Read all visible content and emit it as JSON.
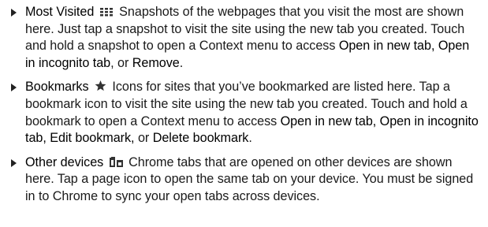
{
  "items": [
    {
      "term": "Most Visited",
      "icon": "grid-icon",
      "text1": " Snapshots of the webpages that you visit the most are shown here. Just tap a snapshot to visit the site using the new tab you created. Touch and hold a snapshot to open a Context menu to access ",
      "kw1": "Open in new tab, Open in incognito tab",
      "sep1": ", or ",
      "kw2": "Remove",
      "end": "."
    },
    {
      "term": "Bookmarks",
      "icon": "star-icon",
      "text1": " Icons for sites that you’ve bookmarked are listed here. Tap a bookmark icon to visit the site using the new tab you created. Touch and hold a bookmark to open a Context menu to access ",
      "kw1": "Open in new tab, Open in incognito tab, Edit bookmark,",
      "sep1": " or ",
      "kw2": "Delete bookmark",
      "end": "."
    },
    {
      "term": "Other devices",
      "icon": "tabs-icon",
      "text1": " Chrome tabs that are opened on other devices are shown here. Tap a page icon to open the same tab on your device. You must be signed in to Chrome to sync your open tabs across devices."
    }
  ],
  "colors": {
    "text": "#1a1a1a",
    "icon": "#333333"
  }
}
